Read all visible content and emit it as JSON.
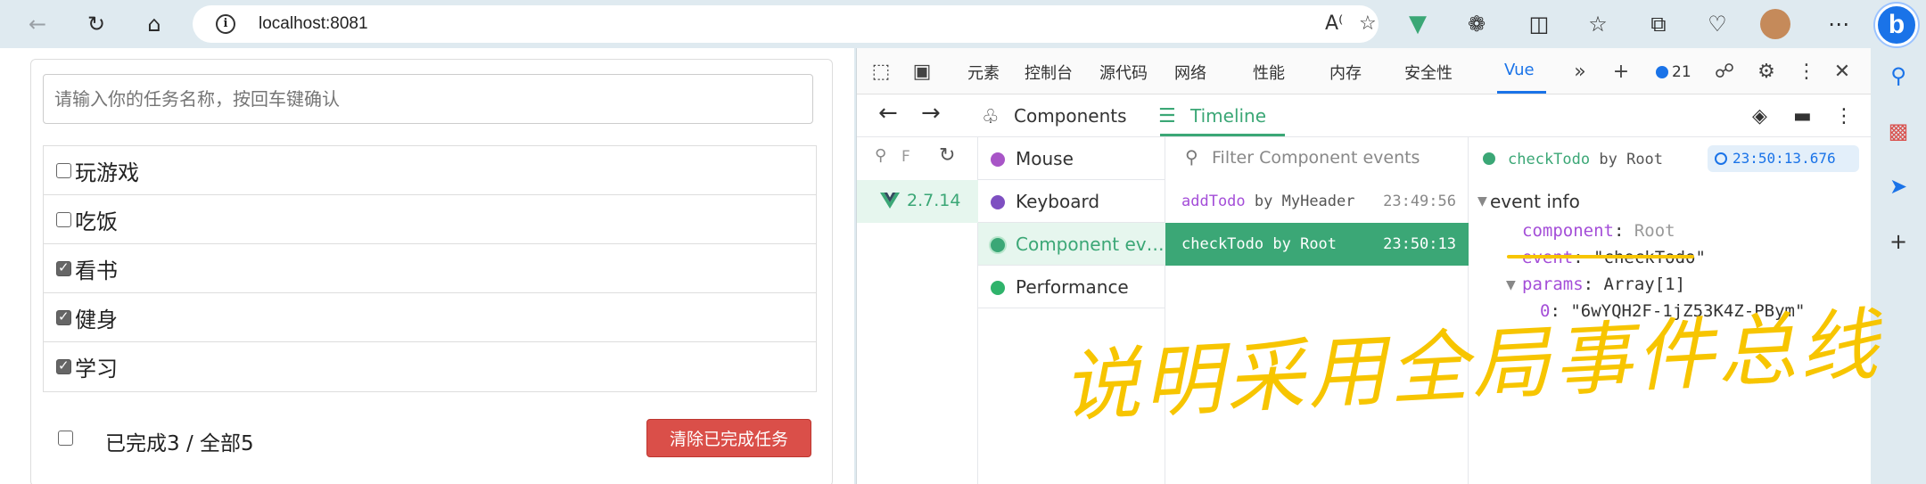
{
  "browser": {
    "url": "localhost:8081",
    "icons": [
      "back-icon",
      "refresh-icon",
      "home-icon",
      "info-icon",
      "read-aloud-icon",
      "favorite-star-icon",
      "vue-devtools-extension-icon",
      "extensions-puzzle-icon",
      "split-screen-icon",
      "favorites-icon",
      "collections-icon",
      "health-icon",
      "profile-avatar",
      "more-icon",
      "bing-icon"
    ]
  },
  "sidebar_icons": [
    "search-icon",
    "tools-briefcase-icon",
    "send-icon",
    "add-icon"
  ],
  "todo": {
    "placeholder": "请输入你的任务名称，按回车键确认",
    "items": [
      {
        "title": "玩游戏",
        "done": false
      },
      {
        "title": "吃饭",
        "done": false
      },
      {
        "title": "看书",
        "done": true
      },
      {
        "title": "健身",
        "done": true
      },
      {
        "title": "学习",
        "done": true
      }
    ],
    "footer": {
      "count_text": "已完成3 / 全部5",
      "all_checked": false
    },
    "clear_label": "清除已完成任务"
  },
  "devtools": {
    "tabs": [
      "元素",
      "控制台",
      "源代码",
      "网络",
      "性能",
      "内存",
      "安全性",
      "Vue"
    ],
    "active_tab": "Vue",
    "issue_count": "21",
    "vue": {
      "sections": {
        "components": "Components",
        "timeline": "Timeline"
      },
      "app_version": "2.7.14",
      "search_prefix": "F",
      "layers": [
        {
          "label": "Mouse",
          "color": "#a855c7",
          "active": false
        },
        {
          "label": "Keyboard",
          "color": "#7e4fc1",
          "active": false
        },
        {
          "label": "Component ev…",
          "color": "#3ba776",
          "active": true
        },
        {
          "label": "Performance",
          "color": "#2fb36b",
          "active": false
        }
      ],
      "events_filter_placeholder": "Filter Component events",
      "events": [
        {
          "name": "addTodo",
          "by": "by MyHeader",
          "time": "23:49:56",
          "selected": false
        },
        {
          "name": "checkTodo",
          "by": "by Root",
          "time": "23:50:13",
          "selected": true
        }
      ],
      "inspector": {
        "event_name": "checkTodo",
        "by": "by Root",
        "time": "23:50:13.676",
        "section_title": "event info",
        "component_key": "component",
        "component_value": "Root",
        "event_key": "event",
        "event_value": "\"checkTodo\"",
        "params_key": "params",
        "params_value": "Array[1]",
        "param0_key": "0",
        "param0_value": "\"6wYQH2F-1jZ53K4Z-PBym\""
      }
    }
  },
  "annotation": {
    "text": "说明采用全局事件总线",
    "color": "#f7c500"
  }
}
